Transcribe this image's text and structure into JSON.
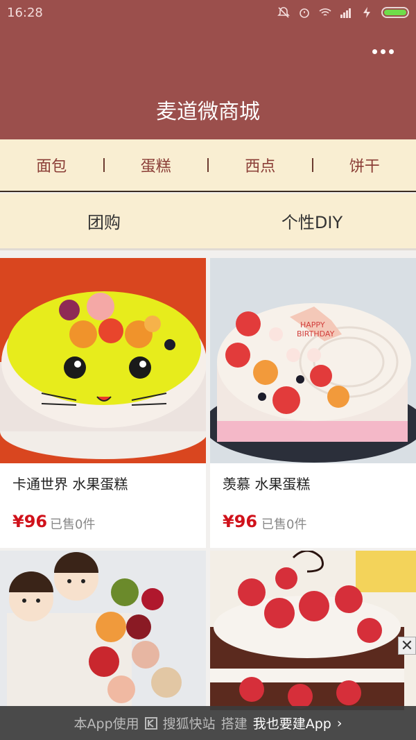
{
  "status": {
    "time": "16:28"
  },
  "header": {
    "title": "麦道微商城"
  },
  "categories": [
    "面包",
    "蛋糕",
    "西点",
    "饼干"
  ],
  "subnav": [
    "团购",
    "个性DIY"
  ],
  "products": [
    {
      "name": "卡通世界 水果蛋糕",
      "price": "¥96",
      "sold": "已售0件"
    },
    {
      "name": "羡慕 水果蛋糕",
      "price": "¥96",
      "sold": "已售0件"
    }
  ],
  "promo": {
    "prefix": "本App使用",
    "brand": "搜狐快站",
    "middle": "搭建",
    "cta": "我也要建App",
    "arrow": "›"
  },
  "close": "✕"
}
